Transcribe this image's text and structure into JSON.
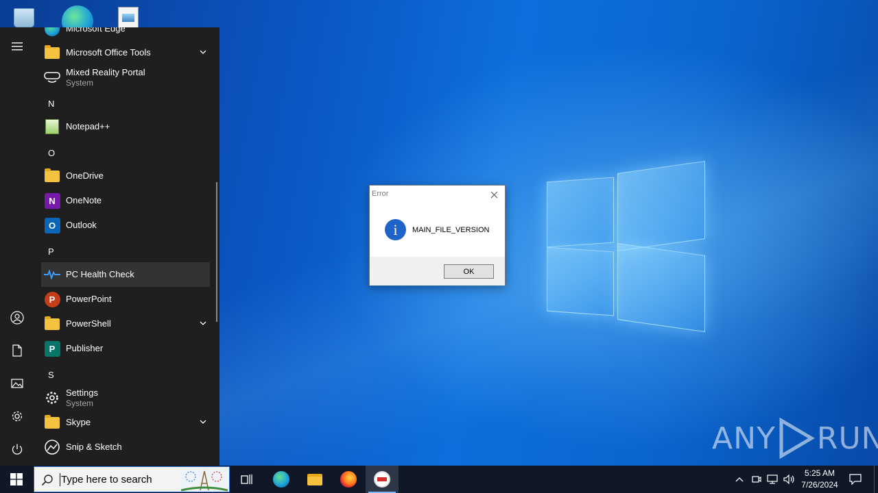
{
  "start_menu": {
    "rail": {
      "menu_icon": "hamburger-menu-icon",
      "items": [
        "user-account-icon",
        "documents-icon",
        "pictures-icon",
        "settings-icon",
        "power-icon"
      ]
    },
    "apps": [
      {
        "name": "Microsoft Edge",
        "sub": "",
        "icon": "edge-icon"
      },
      {
        "name": "Microsoft Office Tools",
        "sub": "",
        "icon": "folder-icon",
        "expandable": true
      },
      {
        "name": "Mixed Reality Portal",
        "sub": "System",
        "icon": "mixed-reality-icon"
      },
      {
        "letter": "N"
      },
      {
        "name": "Notepad++",
        "sub": "",
        "icon": "notepad-plus-plus-icon"
      },
      {
        "letter": "O"
      },
      {
        "name": "OneDrive",
        "sub": "",
        "icon": "onedrive-icon"
      },
      {
        "name": "OneNote",
        "sub": "",
        "icon": "onenote-icon"
      },
      {
        "name": "Outlook",
        "sub": "",
        "icon": "outlook-icon"
      },
      {
        "letter": "P"
      },
      {
        "name": "PC Health Check",
        "sub": "",
        "icon": "pc-health-check-icon",
        "highlighted": true
      },
      {
        "name": "PowerPoint",
        "sub": "",
        "icon": "powerpoint-icon"
      },
      {
        "name": "PowerShell",
        "sub": "",
        "icon": "folder-icon",
        "expandable": true
      },
      {
        "name": "Publisher",
        "sub": "",
        "icon": "publisher-icon"
      },
      {
        "letter": "S"
      },
      {
        "name": "Settings",
        "sub": "System",
        "icon": "settings-icon"
      },
      {
        "name": "Skype",
        "sub": "",
        "icon": "folder-icon",
        "expandable": true
      },
      {
        "name": "Snip & Sketch",
        "sub": "",
        "icon": "snip-sketch-icon"
      }
    ],
    "tile_letters": {
      "onenote": "N",
      "outlook": "O",
      "powerpoint": "P",
      "publisher": "P"
    }
  },
  "dialog": {
    "title": "Error",
    "message": "MAIN_FILE_VERSION",
    "ok_label": "OK",
    "info_glyph": "i",
    "icon": "information-icon"
  },
  "watermark": {
    "left": "ANY",
    "right": "RUN"
  },
  "taskbar": {
    "search_placeholder": "Type here to search",
    "apps": [
      "task-view-icon",
      "edge-icon",
      "file-explorer-icon",
      "firefox-icon",
      "foxit-app-icon"
    ],
    "active_app": "foxit-app-icon",
    "clock": {
      "time": "5:25 AM",
      "date": "7/26/2024"
    },
    "tray": [
      "show-hidden-icons-chevron-icon",
      "meet-now-icon",
      "network-icon",
      "volume-icon",
      "notifications-icon"
    ]
  },
  "colors": {
    "start_bg": "#1f1f1f",
    "taskbar_bg": "#101828",
    "dialog_info": "#1e64c8",
    "highlight": "#333333"
  }
}
